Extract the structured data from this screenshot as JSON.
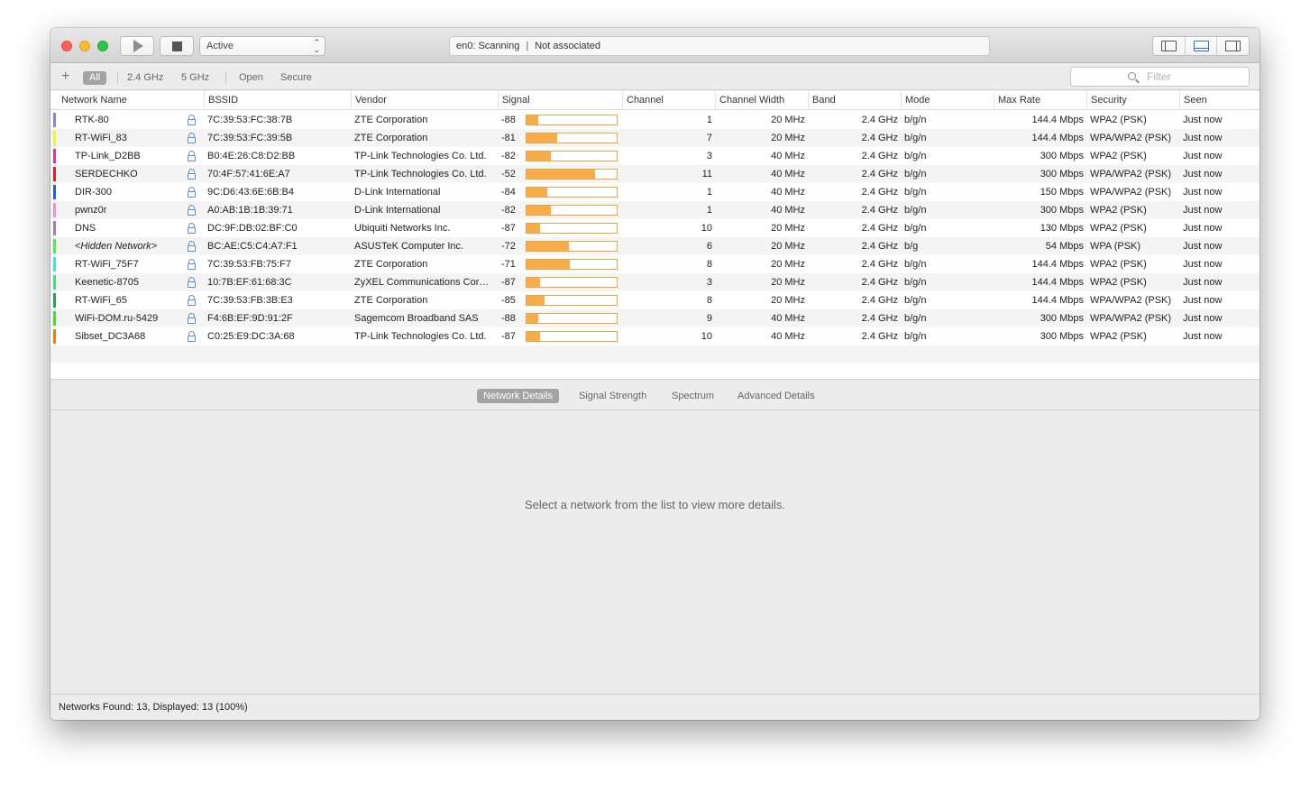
{
  "toolbar": {
    "scan_mode": "Active",
    "interface_status": "en0: Scanning",
    "association_status": "Not associated"
  },
  "filters": {
    "items": [
      "All",
      "2.4 GHz",
      "5 GHz",
      "Open",
      "Secure"
    ],
    "active": "All",
    "search_placeholder": "Filter"
  },
  "columns": [
    "Network Name",
    "BSSID",
    "Vendor",
    "Signal",
    "Channel",
    "Channel Width",
    "Band",
    "Mode",
    "Max Rate",
    "Security",
    "Seen"
  ],
  "networks": [
    {
      "name": "RTK-80",
      "color": "#8e7df0",
      "secure": true,
      "bssid": "7C:39:53:FC:38:7B",
      "vendor": "ZTE Corporation",
      "signal": "-88",
      "signal_fraction": 0.13,
      "channel": "1",
      "width": "20 MHz",
      "band": "2.4 GHz",
      "mode": "b/g/n",
      "max_rate": "144.4 Mbps",
      "security": "WPA2 (PSK)",
      "seen": "Just now"
    },
    {
      "name": "RT-WiFi_83",
      "color": "#f5f222",
      "secure": true,
      "bssid": "7C:39:53:FC:39:5B",
      "vendor": "ZTE Corporation",
      "signal": "-81",
      "signal_fraction": 0.34,
      "channel": "7",
      "width": "20 MHz",
      "band": "2.4 GHz",
      "mode": "b/g/n",
      "max_rate": "144.4 Mbps",
      "security": "WPA/WPA2 (PSK)",
      "seen": "Just now"
    },
    {
      "name": "TP-Link_D2BB",
      "color": "#ec2ba0",
      "secure": true,
      "bssid": "B0:4E:26:C8:D2:BB",
      "vendor": "TP-Link Technologies Co. Ltd.",
      "signal": "-82",
      "signal_fraction": 0.27,
      "channel": "3",
      "width": "40 MHz",
      "band": "2.4 GHz",
      "mode": "b/g/n",
      "max_rate": "300 Mbps",
      "security": "WPA2 (PSK)",
      "seen": "Just now"
    },
    {
      "name": "SERDECHKO",
      "color": "#e81d1d",
      "secure": true,
      "bssid": "70:4F:57:41:6E:A7",
      "vendor": "TP-Link Technologies Co. Ltd.",
      "signal": "-52",
      "signal_fraction": 0.76,
      "channel": "11",
      "width": "40 MHz",
      "band": "2.4 GHz",
      "mode": "b/g/n",
      "max_rate": "300 Mbps",
      "security": "WPA/WPA2 (PSK)",
      "seen": "Just now"
    },
    {
      "name": "DIR-300",
      "color": "#1e63d8",
      "secure": true,
      "bssid": "9C:D6:43:6E:6B:B4",
      "vendor": "D-Link International",
      "signal": "-84",
      "signal_fraction": 0.23,
      "channel": "1",
      "width": "40 MHz",
      "band": "2.4 GHz",
      "mode": "b/g/n",
      "max_rate": "150 Mbps",
      "security": "WPA/WPA2 (PSK)",
      "seen": "Just now"
    },
    {
      "name": "pwnz0r",
      "color": "#ef8fe0",
      "secure": true,
      "bssid": "A0:AB:1B:1B:39:71",
      "vendor": "D-Link International",
      "signal": "-82",
      "signal_fraction": 0.27,
      "channel": "1",
      "width": "40 MHz",
      "band": "2.4 GHz",
      "mode": "b/g/n",
      "max_rate": "300 Mbps",
      "security": "WPA2 (PSK)",
      "seen": "Just now"
    },
    {
      "name": "DNS",
      "color": "#b07aa0",
      "secure": true,
      "bssid": "DC:9F:DB:02:BF:C0",
      "vendor": "Ubiquiti Networks Inc.",
      "signal": "-87",
      "signal_fraction": 0.15,
      "channel": "10",
      "width": "20 MHz",
      "band": "2.4 GHz",
      "mode": "b/g/n",
      "max_rate": "130 Mbps",
      "security": "WPA2 (PSK)",
      "seen": "Just now"
    },
    {
      "name": "<Hidden Network>",
      "hidden": true,
      "color": "#55e84a",
      "secure": true,
      "bssid": "BC:AE:C5:C4:A7:F1",
      "vendor": "ASUSTeK Computer Inc.",
      "signal": "-72",
      "signal_fraction": 0.47,
      "channel": "6",
      "width": "20 MHz",
      "band": "2.4 GHz",
      "mode": "b/g",
      "max_rate": "54 Mbps",
      "security": "WPA (PSK)",
      "seen": "Just now"
    },
    {
      "name": "RT-WiFi_75F7",
      "color": "#3ee0ef",
      "secure": true,
      "bssid": "7C:39:53:FB:75:F7",
      "vendor": "ZTE Corporation",
      "signal": "-71",
      "signal_fraction": 0.48,
      "channel": "8",
      "width": "20 MHz",
      "band": "2.4 GHz",
      "mode": "b/g/n",
      "max_rate": "144.4 Mbps",
      "security": "WPA2 (PSK)",
      "seen": "Just now"
    },
    {
      "name": "Keenetic-8705",
      "color": "#46e07a",
      "secure": true,
      "bssid": "10:7B:EF:61:68:3C",
      "vendor": "ZyXEL Communications Corporation",
      "signal": "-87",
      "signal_fraction": 0.15,
      "channel": "3",
      "width": "20 MHz",
      "band": "2.4 GHz",
      "mode": "b/g/n",
      "max_rate": "144.4 Mbps",
      "security": "WPA2 (PSK)",
      "seen": "Just now"
    },
    {
      "name": "RT-WiFi_65",
      "color": "#1fa84a",
      "secure": true,
      "bssid": "7C:39:53:FB:3B:E3",
      "vendor": "ZTE Corporation",
      "signal": "-85",
      "signal_fraction": 0.2,
      "channel": "8",
      "width": "20 MHz",
      "band": "2.4 GHz",
      "mode": "b/g/n",
      "max_rate": "144.4 Mbps",
      "security": "WPA/WPA2 (PSK)",
      "seen": "Just now"
    },
    {
      "name": "WiFi-DOM.ru-5429",
      "color": "#45e02d",
      "secure": true,
      "bssid": "F4:6B:EF:9D:91:2F",
      "vendor": "Sagemcom Broadband SAS",
      "signal": "-88",
      "signal_fraction": 0.13,
      "channel": "9",
      "width": "40 MHz",
      "band": "2.4 GHz",
      "mode": "b/g/n",
      "max_rate": "300 Mbps",
      "security": "WPA/WPA2 (PSK)",
      "seen": "Just now"
    },
    {
      "name": "Sibset_DC3A68",
      "color": "#f47b12",
      "secure": true,
      "bssid": "C0:25:E9:DC:3A:68",
      "vendor": "TP-Link Technologies Co. Ltd.",
      "signal": "-87",
      "signal_fraction": 0.15,
      "channel": "10",
      "width": "40 MHz",
      "band": "2.4 GHz",
      "mode": "b/g/n",
      "max_rate": "300 Mbps",
      "security": "WPA2 (PSK)",
      "seen": "Just now"
    }
  ],
  "detail_tabs": [
    "Network Details",
    "Signal Strength",
    "Spectrum",
    "Advanced Details"
  ],
  "detail_active_tab": "Network Details",
  "details_placeholder": "Select a network from the list to view more details.",
  "status": "Networks Found: 13, Displayed: 13 (100%)",
  "colors": {
    "signal_fill": "#f7ad48",
    "signal_border": "#f2a23f",
    "active_segment": "#a3a3a3"
  }
}
